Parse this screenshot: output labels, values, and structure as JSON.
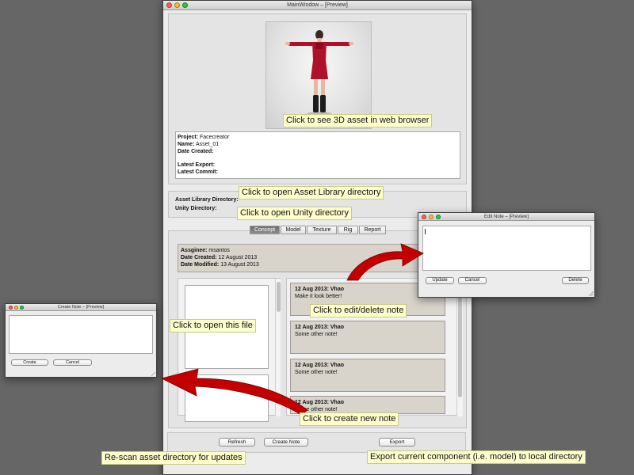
{
  "main_window": {
    "title": "MainWindow – [Preview]",
    "info": {
      "project_label": "Project:",
      "project_value": "Facecreator",
      "name_label": "Name:",
      "name_value": "Asset_01",
      "date_created_label": "Date Created:",
      "latest_export_label": "Latest Export:",
      "latest_commit_label": "Latest Commit:"
    },
    "dirs": {
      "asset_library_label": "Asset Library Directory:",
      "unity_label": "Unity Directory:"
    },
    "tabs": [
      {
        "label": "Concept",
        "active": true
      },
      {
        "label": "Model",
        "active": false
      },
      {
        "label": "Texture",
        "active": false
      },
      {
        "label": "Rig",
        "active": false
      },
      {
        "label": "Report",
        "active": false
      }
    ],
    "component_info": {
      "assignee_label": "Assginee:",
      "assignee_value": "msantos",
      "date_created_label": "Date Created:",
      "date_created_value": "12 August 2013",
      "date_modified_label": "Date Modified:",
      "date_modified_value": "13 August 2013"
    },
    "notes": [
      {
        "header": "12 Aug 2013: Vhao",
        "body": "Make it look better!"
      },
      {
        "header": "12 Aug 2013: Vhao",
        "body": "Some other note!"
      },
      {
        "header": "12 Aug 2013: Vhao",
        "body": "Some other note!"
      },
      {
        "header": "12 Aug 2013: Vhao",
        "body": "Some other note!"
      }
    ],
    "buttons": {
      "refresh": "Refresh",
      "create_note": "Create Note",
      "export": "Export"
    }
  },
  "edit_note_window": {
    "title": "Edit Note – [Preview]",
    "text_value": "",
    "buttons": {
      "update": "Update",
      "cancel": "Cancel",
      "delete": "Delete"
    }
  },
  "create_note_window": {
    "title": "Create Note – [Preview]",
    "text_value": "",
    "buttons": {
      "create": "Create",
      "cancel": "Cancel"
    }
  },
  "callouts": {
    "view_3d": "Click to see 3D asset in web browser",
    "open_asset_library": "Click to open Asset Library directory",
    "open_unity": "Click to open Unity directory",
    "edit_delete_note": "Click to edit/delete note",
    "open_file": "Click to open this file",
    "create_note": "Click to create new note",
    "rescan": "Re-scan asset directory for updates",
    "export": "Export current component (i.e. model) to local directory"
  },
  "colors": {
    "desktop_bg": "#666666",
    "callout_bg": "#ffffcc",
    "arrow": "#c20000",
    "note_bg": "#d8d3cb",
    "character_outfit": "#b0102a"
  },
  "icons": [
    "close-light-icon",
    "minimize-light-icon",
    "zoom-light-icon",
    "curved-arrow-icon",
    "resize-grip-icon"
  ]
}
